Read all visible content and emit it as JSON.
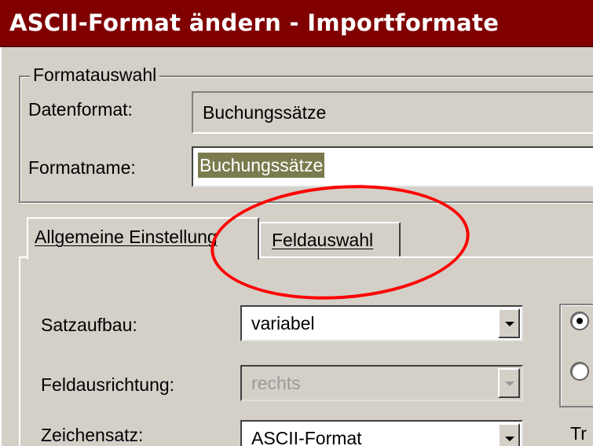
{
  "window": {
    "title": "ASCII-Format ändern - Importformate"
  },
  "format_group": {
    "legend": "Formatauswahl",
    "data_format_label": "Datenformat:",
    "data_format_value": "Buchungssätze",
    "format_name_label": "Formatname:",
    "format_name_value": "Buchungssätze"
  },
  "tabs": [
    {
      "label": "Allgemeine Einstellung",
      "active": true
    },
    {
      "label": "Feldauswahl",
      "active": false
    }
  ],
  "settings": {
    "record_structure_label": "Satzaufbau:",
    "record_structure_value": "variabel",
    "field_alignment_label": "Feldausrichtung:",
    "field_alignment_value": "rechts",
    "charset_label": "Zeichensatz:",
    "charset_value": "ASCII-Format",
    "cut_label": "Tr"
  },
  "radio_options": [
    {
      "checked": true
    },
    {
      "checked": false
    }
  ],
  "annotation": {
    "shape": "ellipse",
    "color": "#ff0000",
    "highlights": "Feldauswahl"
  },
  "colors": {
    "titlebar": "#800000",
    "dialog_bg": "#d4d0c8",
    "selection_bg": "#7a7a4e"
  }
}
